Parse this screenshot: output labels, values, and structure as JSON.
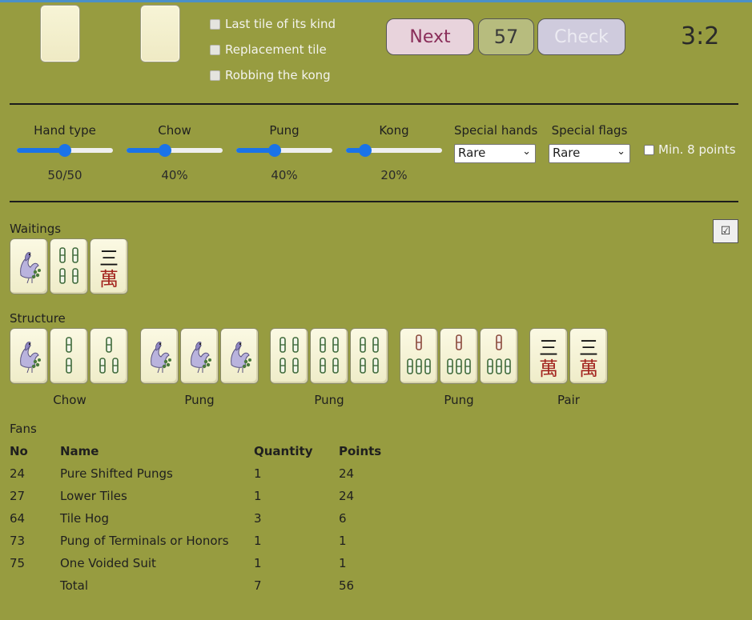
{
  "options": {
    "last_tile": "Last tile of its kind",
    "replacement_tile": "Replacement tile",
    "robbing_kong": "Robbing the kong"
  },
  "buttons": {
    "next": "Next",
    "counter": "57",
    "check": "Check"
  },
  "score": "3:2",
  "sliders": [
    {
      "label": "Hand type",
      "value": "50/50",
      "level": 0.5
    },
    {
      "label": "Chow",
      "value": "40%",
      "level": 0.4
    },
    {
      "label": "Pung",
      "value": "40%",
      "level": 0.4
    },
    {
      "label": "Kong",
      "value": "20%",
      "level": 0.2
    }
  ],
  "selects": {
    "special_hands": {
      "label": "Special hands",
      "value": "Rare"
    },
    "special_flags": {
      "label": "Special flags",
      "value": "Rare"
    }
  },
  "min_points": "Min. 8 points",
  "waitings": {
    "label": "Waitings",
    "toggle": "☑"
  },
  "structure": {
    "label": "Structure",
    "groups": [
      {
        "label": "Chow"
      },
      {
        "label": "Pung"
      },
      {
        "label": "Pung"
      },
      {
        "label": "Pung"
      },
      {
        "label": "Pair"
      }
    ]
  },
  "tile_chars": {
    "three": "三",
    "wan": "萬"
  },
  "fans": {
    "label": "Fans",
    "headers": [
      "No",
      "Name",
      "Quantity",
      "Points"
    ],
    "rows": [
      [
        "24",
        "Pure Shifted Pungs",
        "1",
        "24"
      ],
      [
        "27",
        "Lower Tiles",
        "1",
        "24"
      ],
      [
        "64",
        "Tile Hog",
        "3",
        "6"
      ],
      [
        "73",
        "Pung of Terminals or Honors",
        "1",
        "1"
      ],
      [
        "75",
        "One Voided Suit",
        "1",
        "1"
      ],
      [
        "",
        "Total",
        "7",
        "56"
      ]
    ]
  }
}
